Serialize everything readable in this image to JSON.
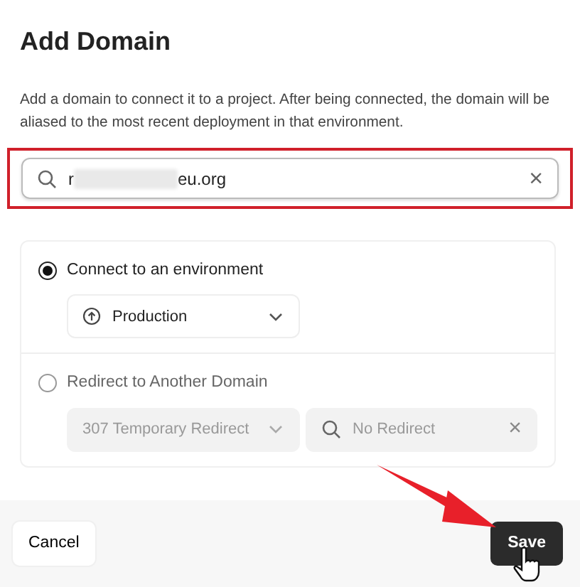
{
  "dialog": {
    "title": "Add Domain",
    "description": "Add a domain to connect it to a project. After being connected, the domain will be aliased to the most recent deployment in that environment.",
    "domain_field": {
      "value_start": "r",
      "value_end": "eu.org",
      "redacted": true,
      "highlighted": true,
      "clear": "×"
    },
    "options": [
      {
        "kind": "environment",
        "label": "Connect to an environment",
        "selected": true,
        "select": "Production"
      },
      {
        "kind": "redirect",
        "label": "Redirect to Another Domain",
        "selected": false,
        "select": "307 Temporary Redirect",
        "placeholder": "No Redirect",
        "clear": "×"
      }
    ],
    "buttons": [
      {
        "kind": "cancel",
        "label": "Cancel"
      },
      {
        "kind": "save",
        "label": "Save",
        "pointed": true
      }
    ]
  }
}
